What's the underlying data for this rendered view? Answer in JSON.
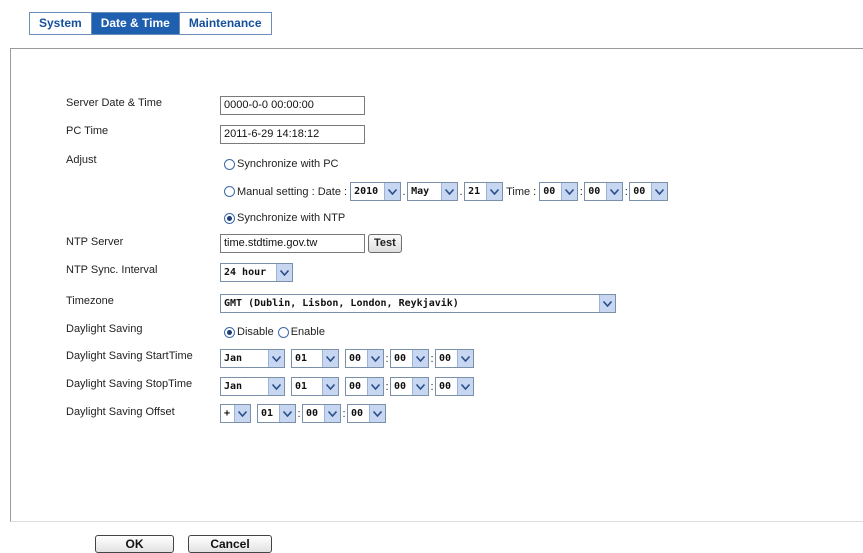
{
  "tabs": [
    "System",
    "Date & Time",
    "Maintenance"
  ],
  "labels": {
    "server_datetime": "Server Date & Time",
    "pc_time": "PC Time",
    "adjust": "Adjust",
    "ntp_server": "NTP Server",
    "ntp_interval": "NTP Sync. Interval",
    "timezone": "Timezone",
    "daylight_saving": "Daylight Saving",
    "dst_start": "Daylight Saving StartTime",
    "dst_stop": "Daylight Saving StopTime",
    "dst_offset": "Daylight Saving Offset"
  },
  "values": {
    "server_datetime": "0000-0-0 00:00:00",
    "pc_time": "2011-6-29 14:18:12",
    "ntp_server": "time.stdtime.gov.tw"
  },
  "adjust": {
    "sync_pc": "Synchronize with PC",
    "manual_date": "Manual setting : Date :",
    "time_label": "Time :",
    "sync_ntp": "Synchronize with NTP",
    "selected": "sync_ntp",
    "year": "2010",
    "month": "May",
    "day": "21",
    "hour": "00",
    "minute": "00",
    "second": "00"
  },
  "test_button": "Test",
  "ntp_interval": "24 hour",
  "timezone": "GMT (Dublin, Lisbon, London, Reykjavik)",
  "daylight": {
    "disable": "Disable",
    "enable": "Enable",
    "selected": "disable"
  },
  "dst_start": {
    "month": "Jan",
    "day": "01",
    "hour": "00",
    "minute": "00",
    "second": "00"
  },
  "dst_stop": {
    "month": "Jan",
    "day": "01",
    "hour": "00",
    "minute": "00",
    "second": "00"
  },
  "dst_offset": {
    "sign": "+",
    "hour": "01",
    "minute": "00",
    "second": "00"
  },
  "buttons": {
    "ok": "OK",
    "cancel": "Cancel"
  },
  "colors": {
    "tab_active": "#1e5fb0",
    "tab_text": "#15509c",
    "dropdown_arrow_bg": "#c7d6f1"
  }
}
